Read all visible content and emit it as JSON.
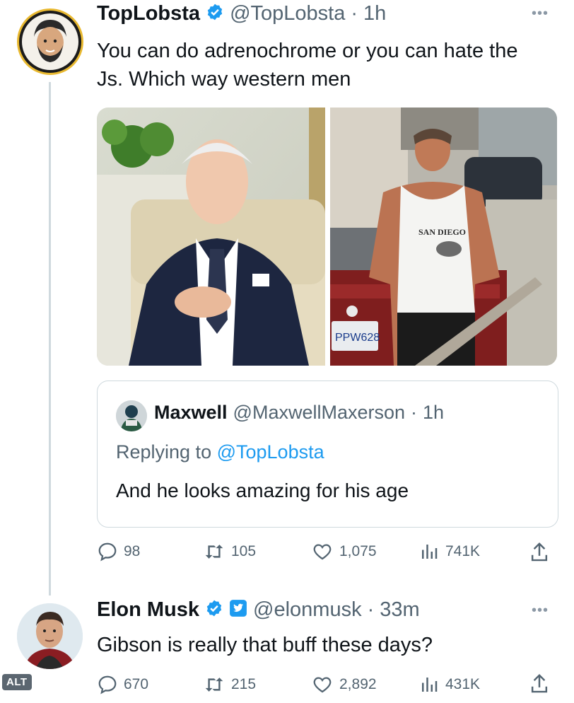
{
  "colors": {
    "verified": "#1d9bf0",
    "text": "#0f1419",
    "muted": "#536471",
    "border": "#cfd9de"
  },
  "tweet1": {
    "name": "TopLobsta",
    "handle": "@TopLobsta",
    "time": "1h",
    "text": "You can do adrenochrome or you can hate the Js. Which way western men",
    "media": {
      "left_plate": "PPW628",
      "right_shirt": "SAN DIEGO"
    },
    "quote": {
      "name": "Maxwell",
      "handle": "@MaxwellMaxerson",
      "time": "1h",
      "replying_prefix": "Replying to ",
      "replying_to": "@TopLobsta",
      "text": "And he looks amazing for his age"
    },
    "actions": {
      "replies": "98",
      "retweets": "105",
      "likes": "1,075",
      "views": "741K"
    }
  },
  "tweet2": {
    "name": "Elon Musk",
    "handle": "@elonmusk",
    "time": "33m",
    "text": "Gibson is really that buff these days?",
    "actions": {
      "replies": "670",
      "retweets": "215",
      "likes": "2,892",
      "views": "431K"
    }
  },
  "alt_badge": "ALT",
  "sep": "·",
  "more_icon": "more-icon"
}
